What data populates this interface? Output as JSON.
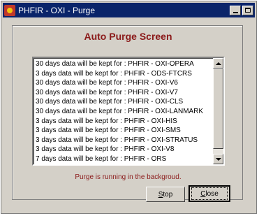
{
  "window": {
    "title": "PHFIR - OXI - Purge"
  },
  "screen_title": "Auto Purge Screen",
  "list": {
    "items": [
      "30 days data will be kept for : PHFIR - OXI-OPERA",
      "3 days data will be kept for : PHFIR - ODS-FTCRS",
      "30 days data will be kept for : PHFIR - OXI-V6",
      "30 days data will be kept for : PHFIR - OXI-V7",
      "30 days data will be kept for : PHFIR - OXI-CLS",
      "30 days data will be kept for : PHFIR - OXI-LANMARK",
      "3 days data will be kept for : PHFIR - OXI-HIS",
      "3 days data will be kept for : PHFIR - OXI-SMS",
      "3 days data will be kept for : PHFIR - OXI-STRATUS",
      "3 days data will be kept for : PHFIR - OXI-V8",
      "7 days data will be kept for : PHFIR - ORS"
    ]
  },
  "status_text": "Purge is running in the backgroud.",
  "buttons": {
    "stop": {
      "mnemonic": "S",
      "rest": "top"
    },
    "close": {
      "mnemonic": "C",
      "rest": "lose"
    }
  },
  "colors": {
    "title_bar": "#0a246a",
    "accent_text": "#8b1a1a",
    "window_bg": "#d4d0c8"
  }
}
